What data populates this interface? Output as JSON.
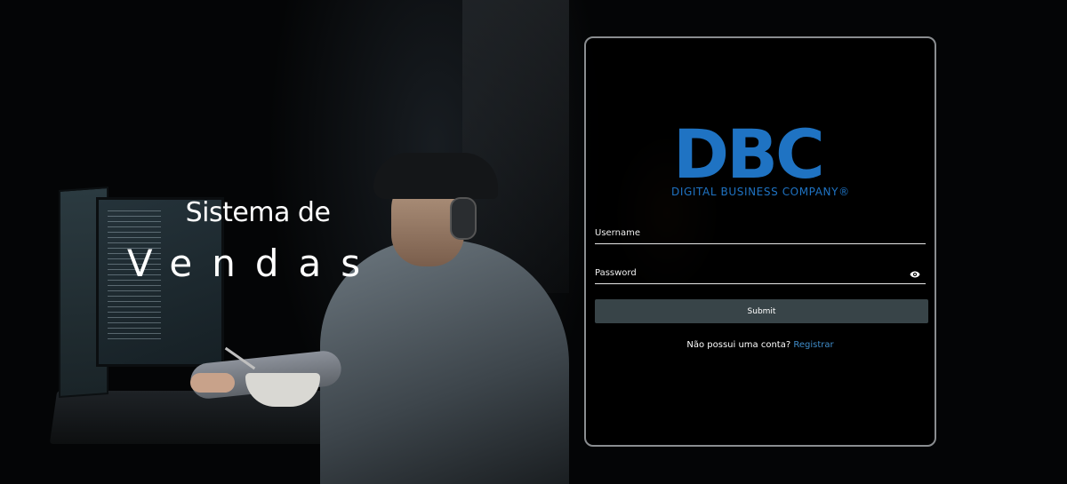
{
  "hero": {
    "title_line1": "Sistema de",
    "title_line2": "Vendas"
  },
  "login": {
    "logo": {
      "mark": "DBC",
      "subtitle": "DIGITAL BUSINESS COMPANY®"
    },
    "username": {
      "placeholder": "Username",
      "value": ""
    },
    "password": {
      "placeholder": "Password",
      "value": ""
    },
    "visibility_icon": "eye-icon",
    "submit_label": "Submit",
    "register_prompt": "Não possui uma conta?",
    "register_link": "Registrar"
  },
  "colors": {
    "brand_blue": "#1f73c3",
    "link_blue": "#3f8cc9",
    "button": "#384448",
    "card_border": "#8a8d90"
  }
}
